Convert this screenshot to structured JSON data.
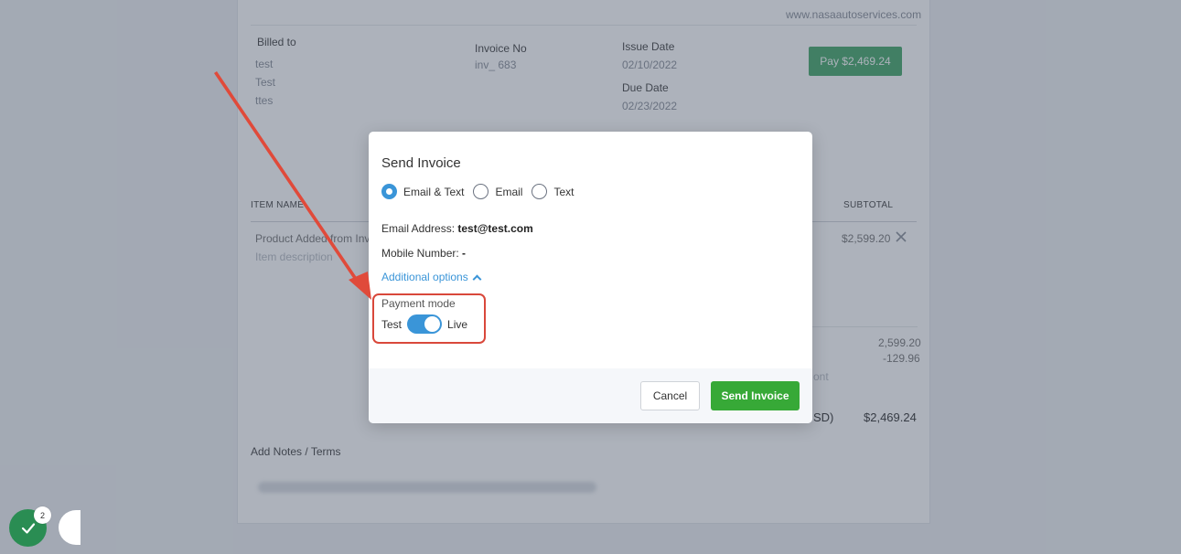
{
  "invoice": {
    "website": "www.nasaautoservices.com",
    "billed_to_label": "Billed to",
    "billed_to_lines": [
      "test",
      "Test",
      "ttes"
    ],
    "invoice_no_label": "Invoice No",
    "invoice_no_value": "inv_ 683",
    "issue_date_label": "Issue Date",
    "issue_date_value": "02/10/2022",
    "due_date_label": "Due Date",
    "due_date_value": "02/23/2022",
    "pay_button": "Pay $2,469.24",
    "table": {
      "col_item": "ITEM NAME",
      "col_subtotal": "SUBTOTAL",
      "item_name": "Product Added from Inv",
      "item_desc": "Item description",
      "item_subtotal": "$2,599.20"
    },
    "summary": {
      "subtotal": "2,599.20",
      "discount": "-129.96",
      "discount_fragment": "ont",
      "total_fragment": "SD)",
      "total": "$2,469.24"
    },
    "notes_label": "Add Notes / Terms"
  },
  "modal": {
    "title": "Send Invoice",
    "radio_options": [
      {
        "label": "Email & Text",
        "checked": true
      },
      {
        "label": "Email",
        "checked": false
      },
      {
        "label": "Text",
        "checked": false
      }
    ],
    "email_label": "Email Address:",
    "email_value": "test@test.com",
    "mobile_label": "Mobile Number:",
    "mobile_value": "-",
    "additional_options": "Additional options",
    "payment_mode_label": "Payment mode",
    "toggle_left": "Test",
    "toggle_right": "Live",
    "toggle_state": "Live",
    "cancel_button": "Cancel",
    "send_button": "Send Invoice"
  },
  "widgets": {
    "badge_count": "2"
  },
  "colors": {
    "accent_blue": "#3a95d8",
    "send_green": "#37a937",
    "annotation_red": "#d9483b",
    "fab_green": "#2a8d53"
  }
}
